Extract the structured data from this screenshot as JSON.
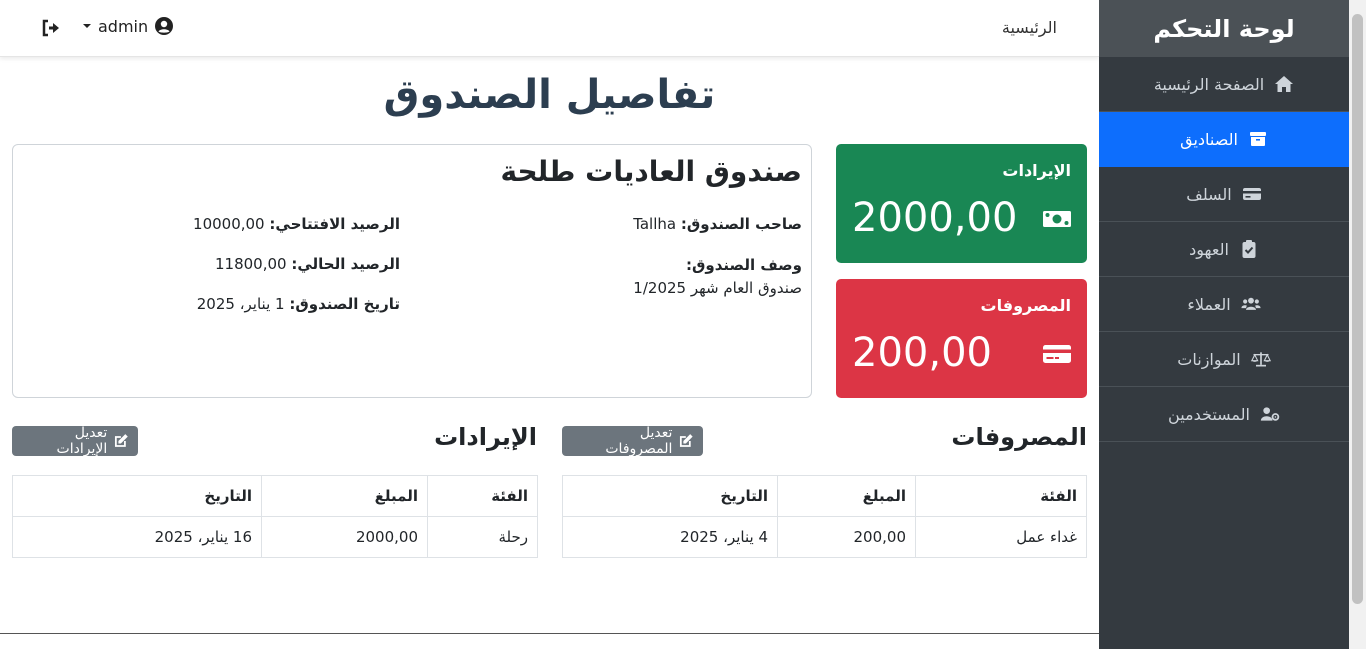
{
  "sidebar": {
    "title": "لوحة التحكم",
    "items": [
      {
        "label": "الصفحة الرئيسية",
        "icon": "home-icon"
      },
      {
        "label": "الصناديق",
        "icon": "box-icon",
        "active": true
      },
      {
        "label": "السلف",
        "icon": "credit-card-icon"
      },
      {
        "label": "العهود",
        "icon": "clipboard-check-icon"
      },
      {
        "label": "العملاء",
        "icon": "users-icon"
      },
      {
        "label": "الموازنات",
        "icon": "balance-scale-icon"
      },
      {
        "label": "المستخدمين",
        "icon": "user-gear-icon"
      }
    ]
  },
  "navbar": {
    "home_link": "الرئيسية",
    "username": "admin"
  },
  "page": {
    "title": "تفاصيل الصندوق"
  },
  "box": {
    "name": "صندوق العاديات طلحة",
    "owner_label": "صاحب الصندوق:",
    "owner_value": "Tallha",
    "desc_label": "وصف الصندوق:",
    "desc_value": "صندوق العام شهر 1/2025",
    "opening_label": "الرصيد الافتتاحي:",
    "opening_value": "10000,00",
    "current_label": "الرصيد الحالي:",
    "current_value": "11800,00",
    "date_label": "تاريخ الصندوق:",
    "date_value": "1 يناير، 2025"
  },
  "stats": {
    "income_label": "الإيرادات",
    "income_value": "2000,00",
    "expense_label": "المصروفات",
    "expense_value": "200,00",
    "income_color": "#198754",
    "expense_color": "#dc3545"
  },
  "expenses": {
    "title": "المصروفات",
    "edit_label": "تعديل المصروفات",
    "headers": [
      "الفئة",
      "المبلغ",
      "التاريخ"
    ],
    "rows": [
      [
        "غداء عمل",
        "200,00",
        "4 يناير، 2025"
      ]
    ]
  },
  "income": {
    "title": "الإيرادات",
    "edit_label": "تعديل الإيرادات",
    "headers": [
      "الفئة",
      "المبلغ",
      "التاريخ"
    ],
    "rows": [
      [
        "رحلة",
        "2000,00",
        "16 يناير، 2025"
      ]
    ]
  }
}
